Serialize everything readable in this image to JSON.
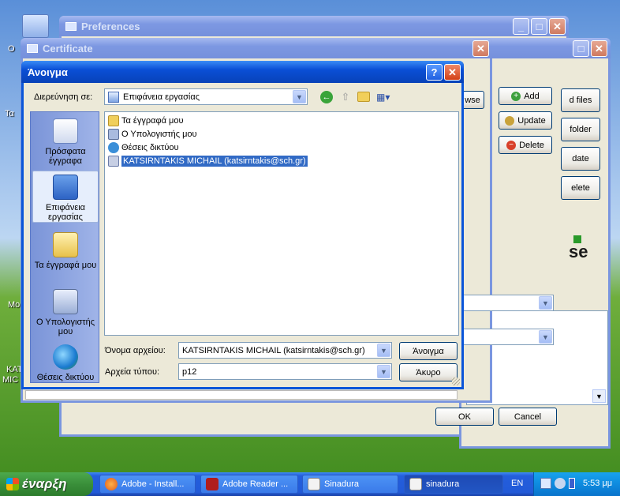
{
  "desktop": {
    "labels": [
      "O",
      "Τα",
      "Mo",
      "KAT",
      "MIC"
    ]
  },
  "preferences": {
    "title": "Preferences",
    "buttons": [
      "Add",
      "Update",
      "Delete"
    ],
    "partial_buttons": [
      "d files",
      "folder",
      "date",
      "elete"
    ],
    "ok": "OK",
    "cancel": "Cancel",
    "logo_fragment": "se"
  },
  "certificate": {
    "title": "Certificate",
    "browse_fragment": "wse"
  },
  "open_dialog": {
    "title": "Άνοιγμα",
    "lookin_label": "Διερεύνηση σε:",
    "lookin_value": "Επιφάνεια εργασίας",
    "places": [
      {
        "label": "Πρόσφατα έγγραφα"
      },
      {
        "label": "Επιφάνεια εργασίας"
      },
      {
        "label": "Τα έγγραφά μου"
      },
      {
        "label": "Ο Υπολογιστής μου"
      },
      {
        "label": "Θέσεις δικτύου"
      }
    ],
    "files": [
      "Τα έγγραφά μου",
      "Ο Υπολογιστής μου",
      "Θέσεις δικτύου",
      "KATSIRNTAKIS MICHAIL (katsirntakis@sch.gr)"
    ],
    "filename_label": "Όνομα αρχείου:",
    "filename_value": "KATSIRNTAKIS MICHAIL (katsirntakis@sch.gr)",
    "filetype_label": "Αρχεία τύπου:",
    "filetype_value": "p12",
    "open_button": "Άνοιγμα",
    "cancel_button": "Άκυρο"
  },
  "taskbar": {
    "start": "έναρξη",
    "tasks": [
      "Adobe - Install...",
      "Adobe Reader ...",
      "Sinadura",
      "sinadura"
    ],
    "lang": "EN",
    "time": "5:53 μμ"
  },
  "colors": {
    "xp_blue": "#0a55d9",
    "selection": "#316ac5",
    "dialog_bg": "#ece9d8"
  }
}
